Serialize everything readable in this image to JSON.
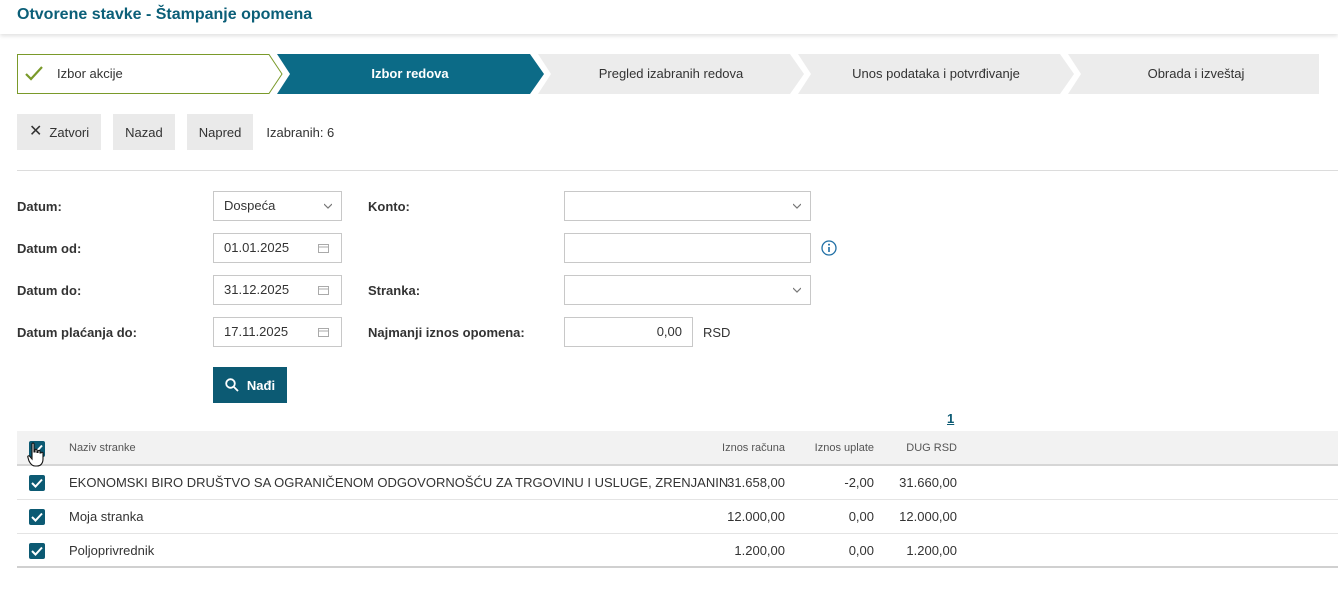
{
  "page": {
    "title": "Otvorene stavke - Štampanje opomena"
  },
  "wizard": {
    "steps": [
      {
        "label": "Izbor akcije",
        "state": "done"
      },
      {
        "label": "Izbor redova",
        "state": "active"
      },
      {
        "label": "Pregled izabranih redova",
        "state": "pending"
      },
      {
        "label": "Unos podataka i potvrđivanje",
        "state": "pending"
      },
      {
        "label": "Obrada i izveštaj",
        "state": "pending"
      }
    ]
  },
  "toolbar": {
    "close_label": "Zatvori",
    "back_label": "Nazad",
    "next_label": "Napred",
    "selected_label": "Izabranih: 6"
  },
  "filters": {
    "date_label": "Datum:",
    "date_value": "Dospeća",
    "date_from_label": "Datum od:",
    "date_from_value": "01.01.2025",
    "date_to_label": "Datum do:",
    "date_to_value": "31.12.2025",
    "pay_date_label": "Datum plaćanja do:",
    "pay_date_value": "17.11.2025",
    "account_label": "Konto:",
    "account_value": "",
    "account_extra_value": "",
    "party_label": "Stranka:",
    "party_value": "",
    "min_amount_label": "Najmanji iznos opomena:",
    "min_amount_value": "0,00",
    "currency": "RSD",
    "search_label": "Nađi"
  },
  "pager": {
    "current": "1"
  },
  "table": {
    "headers": [
      "Naziv stranke",
      "Iznos računa",
      "Iznos uplate",
      "DUG RSD"
    ],
    "rows": [
      {
        "name": "EKONOMSKI BIRO DRUŠTVO SA OGRANIČENOM ODGOVORNOŠĆU ZA TRGOVINU I USLUGE, ZRENJANIN",
        "invoice": "31.658,00",
        "payment": "-2,00",
        "debt": "31.660,00",
        "checked": true
      },
      {
        "name": "Moja stranka",
        "invoice": "12.000,00",
        "payment": "0,00",
        "debt": "12.000,00",
        "checked": true
      },
      {
        "name": "Poljoprivrednik",
        "invoice": "1.200,00",
        "payment": "0,00",
        "debt": "1.200,00",
        "checked": true
      }
    ]
  },
  "colors": {
    "accent": "#0c5a73",
    "done_border": "#7a9a2a",
    "pending": "#ececec"
  }
}
